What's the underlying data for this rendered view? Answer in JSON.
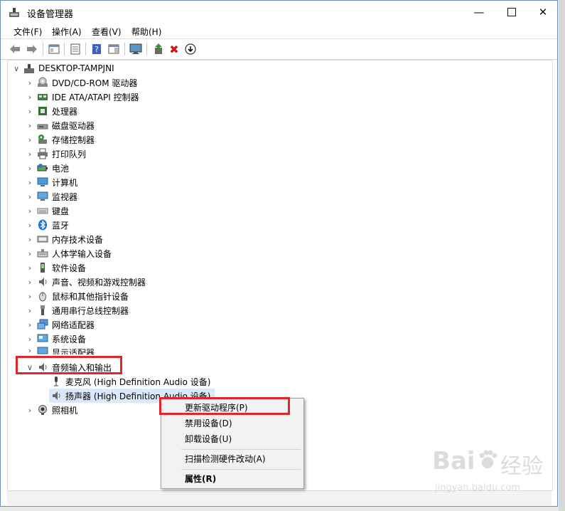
{
  "window": {
    "title": "设备管理器"
  },
  "menubar": {
    "items": [
      "文件(F)",
      "操作(A)",
      "查看(V)",
      "帮助(H)"
    ]
  },
  "tree": {
    "root": "DESKTOP-TAMPJNI",
    "categories": [
      "DVD/CD-ROM 驱动器",
      "IDE ATA/ATAPI 控制器",
      "处理器",
      "磁盘驱动器",
      "存储控制器",
      "打印队列",
      "电池",
      "计算机",
      "监视器",
      "键盘",
      "蓝牙",
      "内存技术设备",
      "人体学输入设备",
      "软件设备",
      "声音、视频和游戏控制器",
      "鼠标和其他指针设备",
      "通用串行总线控制器",
      "网络适配器",
      "系统设备",
      "显示适配器"
    ],
    "expanded": "音频输入和输出",
    "children": [
      "麦克风 (High Definition Audio 设备)",
      "扬声器 (High Definition Audio 设备)"
    ],
    "after": "照相机"
  },
  "context_menu": {
    "items": [
      "更新驱动程序(P)",
      "禁用设备(D)",
      "卸载设备(U)",
      "扫描检测硬件改动(A)",
      "属性(R)"
    ]
  },
  "watermark": {
    "brand": "Bai",
    "brand2": "经验",
    "url": "jingyan.baidu.com"
  },
  "colors": {
    "highlight": "#e0262d",
    "selection": "#d9e8fb"
  }
}
